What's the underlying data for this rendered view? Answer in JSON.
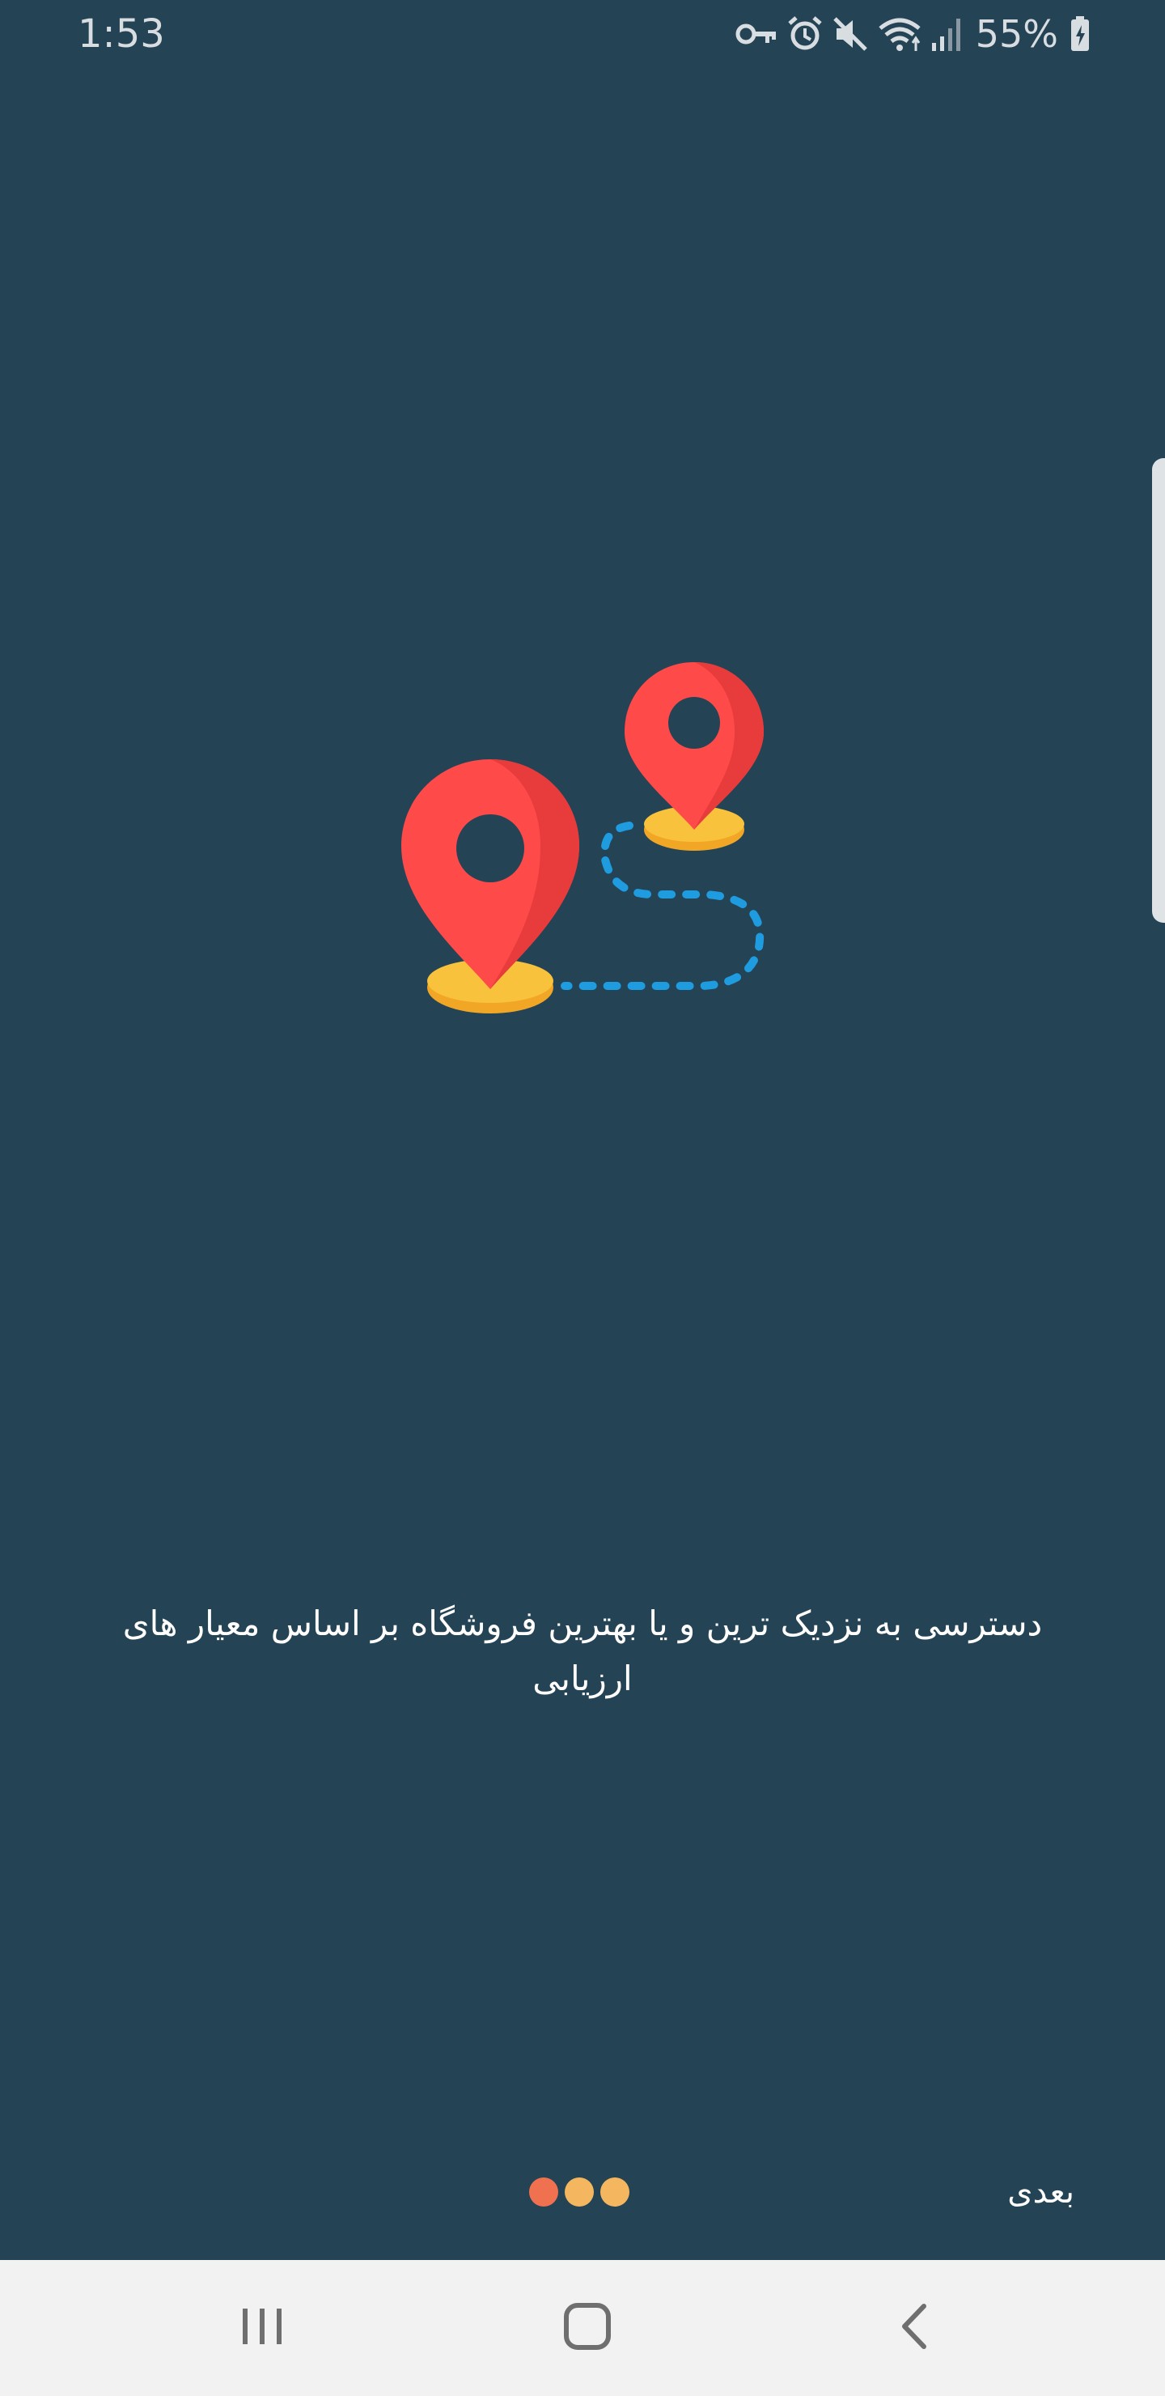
{
  "status_bar": {
    "time": "1:53",
    "battery_percent": "55%",
    "icons": [
      "vpn-key-icon",
      "alarm-icon",
      "mute-icon",
      "wifi-icon",
      "signal-icon",
      "battery-charging-icon"
    ]
  },
  "onboarding": {
    "illustration": "map-pins-route-icon",
    "description": "دسترسی به نزدیک ترین و یا بهترین فروشگاه بر اساس معیار های ارزیابی",
    "page_indicator": {
      "total": 3,
      "current": 1,
      "colors": [
        "#f0714f",
        "#f4b65f",
        "#f4b65f"
      ]
    },
    "next_label": "بعدی"
  },
  "navigation_bar": {
    "buttons": [
      "recents-icon",
      "home-icon",
      "back-icon"
    ]
  },
  "colors": {
    "background": "#244456",
    "pin_red": "#ff4a4a",
    "pin_base": "#f9c23c",
    "route_blue": "#1f9be0"
  }
}
